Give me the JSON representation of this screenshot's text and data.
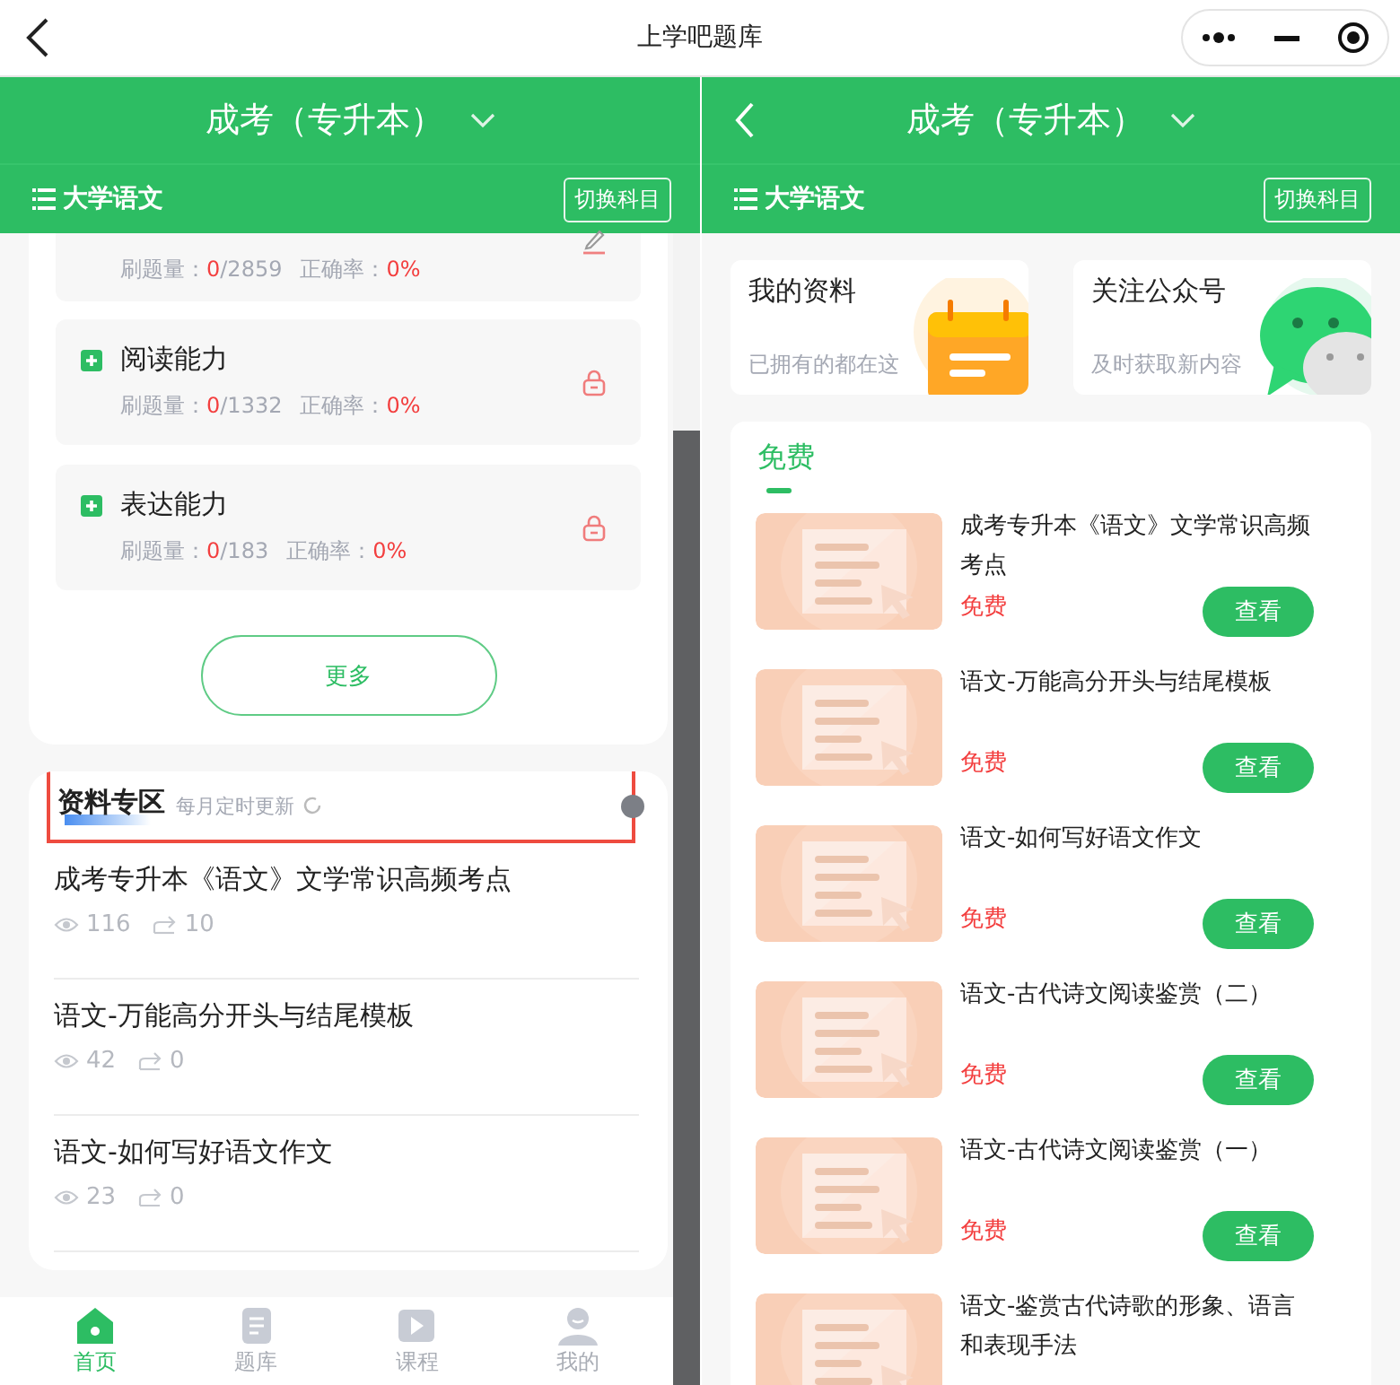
{
  "top_bar": {
    "title": "上学吧题库"
  },
  "left": {
    "header": {
      "title": "成考（专升本）",
      "subject": "大学语文",
      "switch_button": "切换科目"
    },
    "chapters": [
      {
        "kind": "pencil",
        "done_label": "刷题量：",
        "done": "0",
        "total": "/2859",
        "rate_label": "正确率：",
        "rate": "0%"
      },
      {
        "kind": "lock",
        "title": "阅读能力",
        "done_label": "刷题量：",
        "done": "0",
        "total": "/1332",
        "rate_label": "正确率：",
        "rate": "0%"
      },
      {
        "kind": "lock",
        "title": "表达能力",
        "done_label": "刷题量：",
        "done": "0",
        "total": "/183",
        "rate_label": "正确率：",
        "rate": "0%"
      }
    ],
    "more_button": "更多",
    "materials": {
      "title": "资料专区",
      "subtitle": "每月定时更新",
      "items": [
        {
          "title": "成考专升本《语文》文学常识高频考点",
          "views": "116",
          "shares": "10"
        },
        {
          "title": "语文-万能高分开头与结尾模板",
          "views": "42",
          "shares": "0"
        },
        {
          "title": "语文-如何写好语文作文",
          "views": "23",
          "shares": "0"
        }
      ]
    },
    "tab_bar": [
      {
        "kind": "home",
        "label": "首页",
        "selected": true
      },
      {
        "kind": "book",
        "label": "题库",
        "selected": false
      },
      {
        "kind": "play",
        "label": "课程",
        "selected": false
      },
      {
        "kind": "person",
        "label": "我的",
        "selected": false
      }
    ]
  },
  "right": {
    "header": {
      "title": "成考（专升本）",
      "subject": "大学语文",
      "switch_button": "切换科目"
    },
    "promo_cards": [
      {
        "kind": "calendar",
        "title": "我的资料",
        "subtitle": "已拥有的都在这"
      },
      {
        "kind": "chat",
        "title": "关注公众号",
        "subtitle": "及时获取新内容"
      }
    ],
    "tab": {
      "label": "免费",
      "selected": true
    },
    "items": [
      {
        "title": "成考专升本《语文》文学常识高频考点",
        "price": "免费",
        "button": "查看"
      },
      {
        "title": "语文-万能高分开头与结尾模板",
        "price": "免费",
        "button": "查看"
      },
      {
        "title": "语文-如何写好语文作文",
        "price": "免费",
        "button": "查看"
      },
      {
        "title": "语文-古代诗文阅读鉴赏（二）",
        "price": "免费",
        "button": "查看"
      },
      {
        "title": "语文-古代诗文阅读鉴赏（一）",
        "price": "免费",
        "button": "查看"
      },
      {
        "title": "语文-鉴赏古代诗歌的形象、语言和表现手法"
      }
    ]
  }
}
